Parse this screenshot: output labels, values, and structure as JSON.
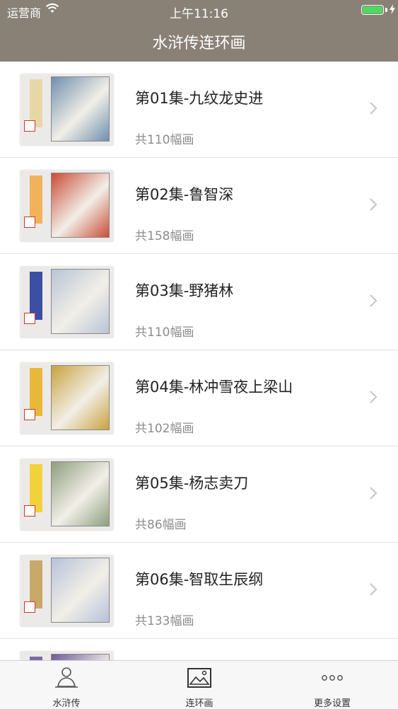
{
  "status": {
    "carrier": "运营商",
    "time": "上午11:16"
  },
  "nav": {
    "title": "水浒传连环画"
  },
  "episodes": [
    {
      "title": "第01集-九纹龙史进",
      "count": "共110幅画"
    },
    {
      "title": "第02集-鲁智深",
      "count": "共158幅画"
    },
    {
      "title": "第03集-野猪林",
      "count": "共110幅画"
    },
    {
      "title": "第04集-林冲雪夜上梁山",
      "count": "共102幅画"
    },
    {
      "title": "第05集-杨志卖刀",
      "count": "共86幅画"
    },
    {
      "title": "第06集-智取生辰纲",
      "count": "共133幅画"
    },
    {
      "title": "",
      "count": ""
    }
  ],
  "tabs": [
    {
      "label": "水浒传",
      "icon": "meditation-icon"
    },
    {
      "label": "连环画",
      "icon": "picture-icon"
    },
    {
      "label": "更多设置",
      "icon": "more-dots-icon"
    }
  ],
  "colors": {
    "bar": "#8a8176",
    "strips": [
      "#e8d7a6",
      "#f0b35a",
      "#3b4fa3",
      "#e8b83a",
      "#f2d23a",
      "#c9a96a",
      "#7b6aa8"
    ],
    "arts": [
      "#6f8fae",
      "#c94d36",
      "#b9c4d6",
      "#c9a23e",
      "#8d9e7e",
      "#b7c2d9",
      "#6c5a9a"
    ]
  }
}
